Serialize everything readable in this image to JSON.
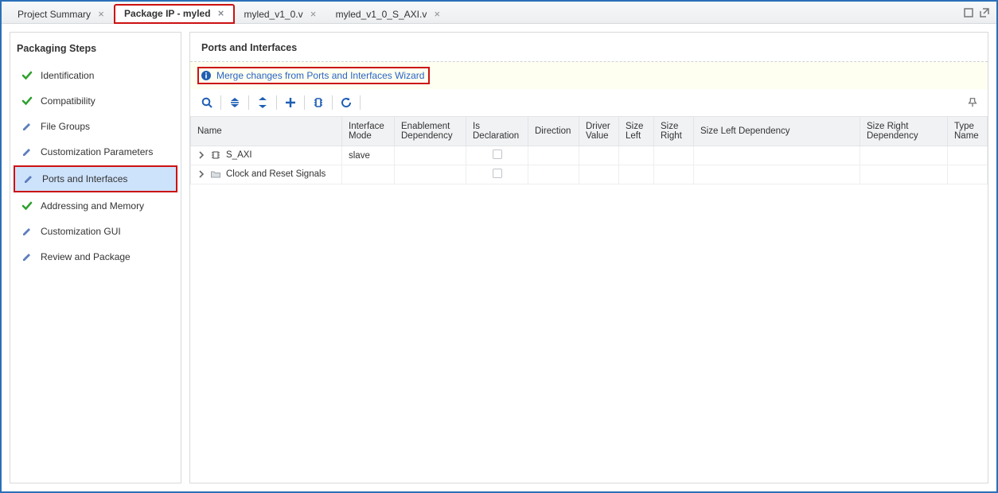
{
  "tabs": [
    {
      "label": "Project Summary"
    },
    {
      "label": "Package IP - myled"
    },
    {
      "label": "myled_v1_0.v"
    },
    {
      "label": "myled_v1_0_S_AXI.v"
    }
  ],
  "sidebar": {
    "title": "Packaging Steps",
    "steps": [
      {
        "label": "Identification",
        "status": "check"
      },
      {
        "label": "Compatibility",
        "status": "check"
      },
      {
        "label": "File Groups",
        "status": "edit"
      },
      {
        "label": "Customization Parameters",
        "status": "edit"
      },
      {
        "label": "Ports and Interfaces",
        "status": "edit"
      },
      {
        "label": "Addressing and Memory",
        "status": "check"
      },
      {
        "label": "Customization GUI",
        "status": "edit"
      },
      {
        "label": "Review and Package",
        "status": "edit"
      }
    ]
  },
  "main": {
    "title": "Ports and Interfaces",
    "notice_link": "Merge changes from Ports and Interfaces Wizard",
    "columns": {
      "name": "Name",
      "interface_mode": "Interface Mode",
      "enablement_dependency": "Enablement Dependency",
      "is_declaration": "Is Declaration",
      "direction": "Direction",
      "driver_value": "Driver Value",
      "size_left": "Size Left",
      "size_right": "Size Right",
      "size_left_dep": "Size Left Dependency",
      "size_right_dep": "Size Right Dependency",
      "type_name": "Type Name"
    },
    "rows": [
      {
        "name": "S_AXI",
        "interface_mode": "slave",
        "icon": "bus"
      },
      {
        "name": "Clock and Reset Signals",
        "interface_mode": "",
        "icon": "folder"
      }
    ]
  }
}
